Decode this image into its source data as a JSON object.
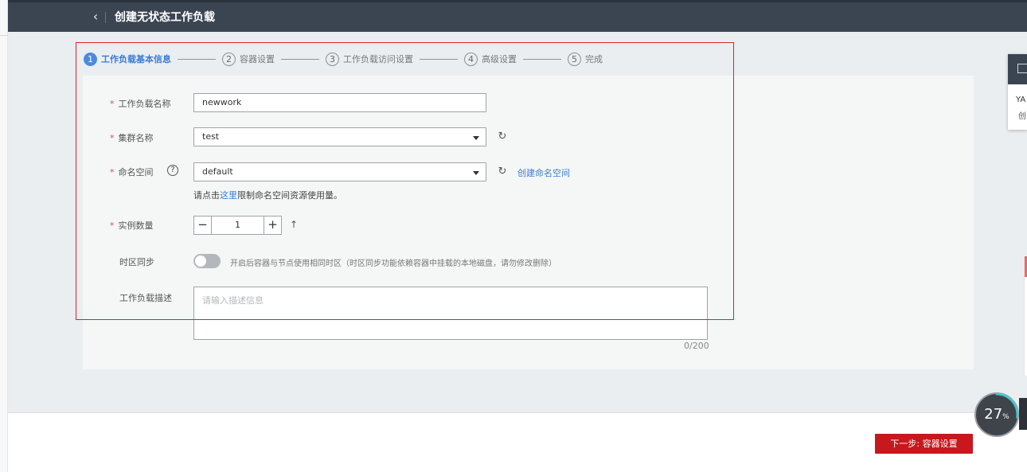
{
  "header": {
    "back_icon": "chevron-left-icon",
    "title": "创建无状态工作负载"
  },
  "steps": [
    {
      "num": "1",
      "label": "工作负载基本信息",
      "active": true
    },
    {
      "num": "2",
      "label": "容器设置",
      "active": false
    },
    {
      "num": "3",
      "label": "工作负载访问设置",
      "active": false
    },
    {
      "num": "4",
      "label": "高级设置",
      "active": false
    },
    {
      "num": "5",
      "label": "完成",
      "active": false
    }
  ],
  "form": {
    "required_mark": "*",
    "workload_name": {
      "label": "工作负载名称",
      "value": "newwork"
    },
    "cluster": {
      "label": "集群名称",
      "value": "test"
    },
    "namespace": {
      "label": "命名空间",
      "value": "default",
      "create_link": "创建命名空间",
      "hint_prefix": "请点击",
      "hint_link": "这里",
      "hint_suffix": "限制命名空间资源使用量。"
    },
    "instances": {
      "label": "实例数量",
      "value": "1",
      "minus": "−",
      "plus": "+",
      "arrow": "↑"
    },
    "timezone": {
      "label": "时区同步",
      "enabled": false,
      "description": "开启后容器与节点使用相同时区（时区同步功能依赖容器中挂载的本地磁盘，请勿修改删除）"
    },
    "description": {
      "label": "工作负载描述",
      "placeholder": "请输入描述信息",
      "counter": "0/200"
    }
  },
  "footer": {
    "next_button": "下一步: 容器设置"
  },
  "side_panel": {
    "text1": "YA",
    "text2": "创"
  },
  "gauge": {
    "value": "27",
    "unit": "%",
    "fraction": 0.27
  },
  "colors": {
    "accent": "#3a7bd5",
    "primary_button": "#c8171d",
    "header_bg": "#3b4552",
    "highlight_box": "#d6252b"
  }
}
